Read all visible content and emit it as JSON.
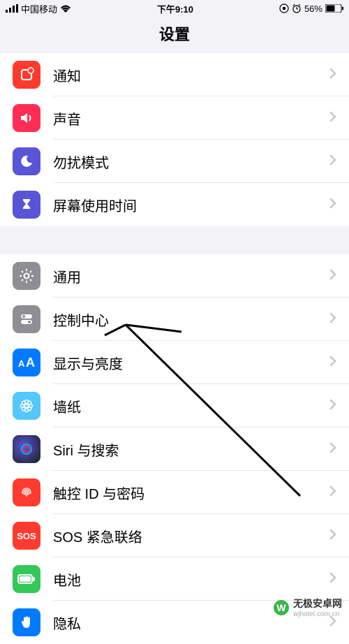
{
  "status_bar": {
    "signal_label": "signal-icon",
    "carrier": "中国移动",
    "wifi_label": "wifi-icon",
    "time": "下午9:10",
    "lock_label": "rotation-lock-icon",
    "alarm_label": "alarm-icon",
    "battery_percent": "56%",
    "battery_label": "battery-icon"
  },
  "header": {
    "title": "设置"
  },
  "sections": {
    "g1": {
      "notifications": {
        "label": "通知",
        "color": "#ff3b30"
      },
      "sound": {
        "label": "声音",
        "color": "#ff3b30"
      },
      "dnd": {
        "label": "勿扰模式",
        "color": "#5856d6"
      },
      "screentime": {
        "label": "屏幕使用时间",
        "color": "#5856d6"
      }
    },
    "g2": {
      "general": {
        "label": "通用",
        "color": "#8e8e93"
      },
      "control_center": {
        "label": "控制中心",
        "color": "#8e8e93"
      },
      "display": {
        "label": "显示与亮度",
        "color": "#007aff"
      },
      "wallpaper": {
        "label": "墙纸",
        "color": "#54c7fc"
      },
      "siri": {
        "label": "Siri 与搜索",
        "color": "#1c1c1e"
      },
      "touchid": {
        "label": "触控 ID 与密码",
        "color": "#ff3b30"
      },
      "sos": {
        "label": "SOS 紧急联络",
        "color": "#ff3b30"
      },
      "battery": {
        "label": "电池",
        "color": "#34c759"
      },
      "privacy": {
        "label": "隐私",
        "color": "#007aff"
      }
    }
  },
  "watermark": {
    "cn": "无极安卓网",
    "url": "wjhotel.com.cn"
  }
}
